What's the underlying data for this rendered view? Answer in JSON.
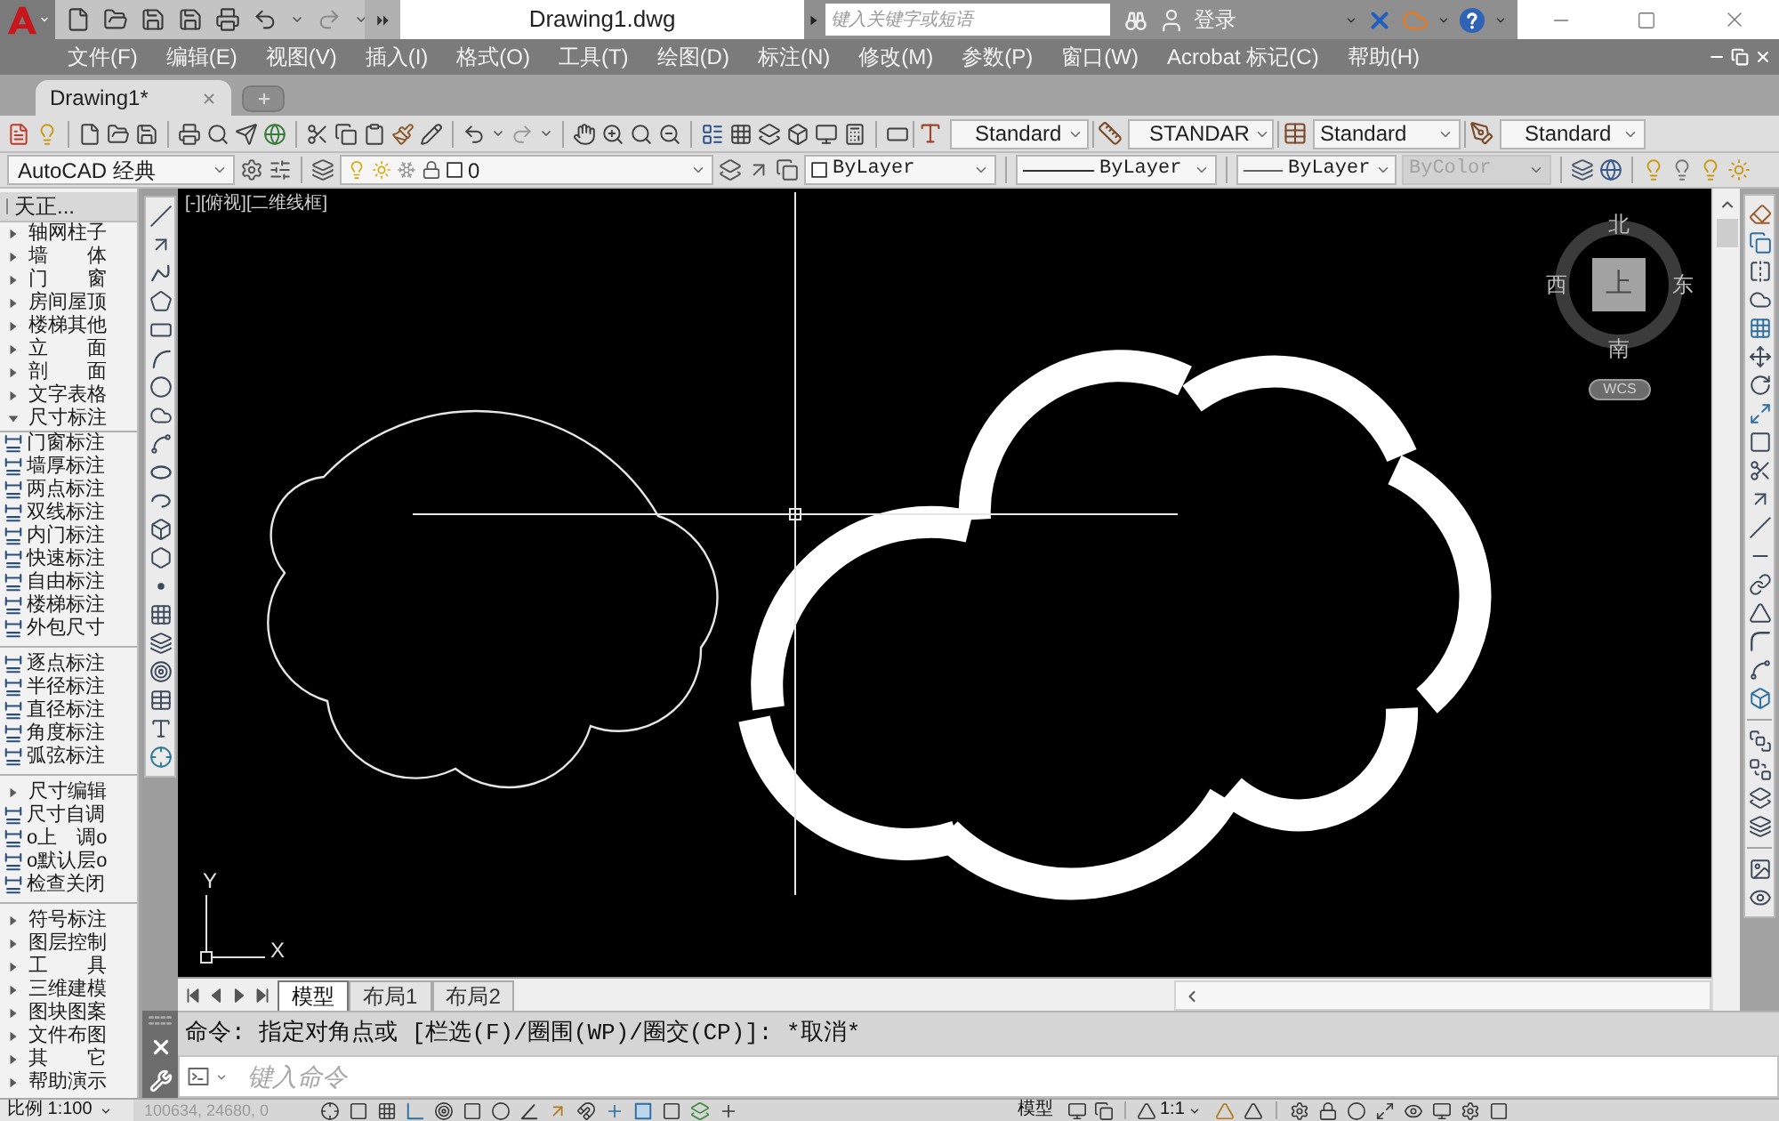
{
  "title_bar": {
    "file_name": "Drawing1.dwg",
    "search": {
      "placeholder": "键入关键字或短语"
    },
    "sign_in": "登录"
  },
  "menu_bar": [
    "文件(F)",
    "编辑(E)",
    "视图(V)",
    "插入(I)",
    "格式(O)",
    "工具(T)",
    "绘图(D)",
    "标注(N)",
    "修改(M)",
    "参数(P)",
    "窗口(W)",
    "Acrobat 标记(C)",
    "帮助(H)"
  ],
  "document_tabs": [
    {
      "label": "Drawing1*",
      "selected": true
    }
  ],
  "styles_toolbar": {
    "text_style": "Standard",
    "dimension_style": "STANDAR",
    "table_style": "Standard",
    "multileader_style": "Standard"
  },
  "properties_toolbar": {
    "workspace": "AutoCAD 经典",
    "layer": "0",
    "color_control": "ByLayer",
    "linetype": "ByLayer",
    "lineweight": "ByLayer",
    "plot_style": {
      "value": "ByColor",
      "disabled": true
    }
  },
  "palette": {
    "title": "天正...",
    "items": [
      {
        "kind": "folder",
        "label": "轴网柱子",
        "expanded": false
      },
      {
        "kind": "folder",
        "label": "墙　　体",
        "expanded": false
      },
      {
        "kind": "folder",
        "label": "门　　窗",
        "expanded": false
      },
      {
        "kind": "folder",
        "label": "房间屋顶",
        "expanded": false
      },
      {
        "kind": "folder",
        "label": "楼梯其他",
        "expanded": false
      },
      {
        "kind": "folder",
        "label": "立　　面",
        "expanded": false
      },
      {
        "kind": "folder",
        "label": "剖　　面",
        "expanded": false
      },
      {
        "kind": "folder",
        "label": "文字表格",
        "expanded": false
      },
      {
        "kind": "folder",
        "label": "尺寸标注",
        "expanded": true,
        "children": [
          {
            "kind": "command",
            "label": "门窗标注"
          },
          {
            "kind": "command",
            "label": "墙厚标注"
          },
          {
            "kind": "command",
            "label": "两点标注"
          },
          {
            "kind": "command",
            "label": "双线标注"
          },
          {
            "kind": "command",
            "label": "内门标注"
          },
          {
            "kind": "command",
            "label": "快速标注"
          },
          {
            "kind": "command",
            "label": "自由标注"
          },
          {
            "kind": "command",
            "label": "楼梯标注"
          },
          {
            "kind": "command",
            "label": "外包尺寸"
          },
          {
            "kind": "divider"
          },
          {
            "kind": "command",
            "label": "逐点标注"
          },
          {
            "kind": "command",
            "label": "半径标注"
          },
          {
            "kind": "command",
            "label": "直径标注"
          },
          {
            "kind": "command",
            "label": "角度标注"
          },
          {
            "kind": "command",
            "label": "弧弦标注"
          },
          {
            "kind": "divider"
          },
          {
            "kind": "folder",
            "label": "尺寸编辑",
            "expanded": false
          },
          {
            "kind": "command",
            "label": "尺寸自调"
          },
          {
            "kind": "command",
            "label": "o上　调o"
          },
          {
            "kind": "command",
            "label": "o默认层o"
          },
          {
            "kind": "command",
            "label": "检查关闭"
          }
        ]
      },
      {
        "kind": "divider"
      },
      {
        "kind": "folder",
        "label": "符号标注",
        "expanded": false
      },
      {
        "kind": "folder",
        "label": "图层控制",
        "expanded": false
      },
      {
        "kind": "folder",
        "label": "工　　具",
        "expanded": false
      },
      {
        "kind": "folder",
        "label": "三维建模",
        "expanded": false
      },
      {
        "kind": "folder",
        "label": "图块图案",
        "expanded": false
      },
      {
        "kind": "folder",
        "label": "文件布图",
        "expanded": false
      },
      {
        "kind": "folder",
        "label": "其　　它",
        "expanded": false
      },
      {
        "kind": "folder",
        "label": "帮助演示",
        "expanded": false
      }
    ]
  },
  "viewport": {
    "label": "[-][俯视][二维线框]",
    "view_cube": {
      "top": "上",
      "north": "北",
      "east": "东",
      "south": "南",
      "west": "西",
      "wcs": "WCS"
    },
    "ucs": {
      "x_axis": "X",
      "y_axis": "Y"
    }
  },
  "layout_tabs": [
    {
      "label": "模型",
      "selected": true
    },
    {
      "label": "布局1",
      "selected": false
    },
    {
      "label": "布局2",
      "selected": false
    }
  ],
  "command_line": {
    "history": "命令: 指定对角点或 [栏选(F)/圈围(WP)/圈交(CP)]: *取消*",
    "placeholder": "键入命令"
  },
  "status_bar": {
    "scale": "比例 1:100",
    "coordinates": "100634, 24680, 0",
    "space": "模型",
    "annotation_scale": "1:1"
  }
}
